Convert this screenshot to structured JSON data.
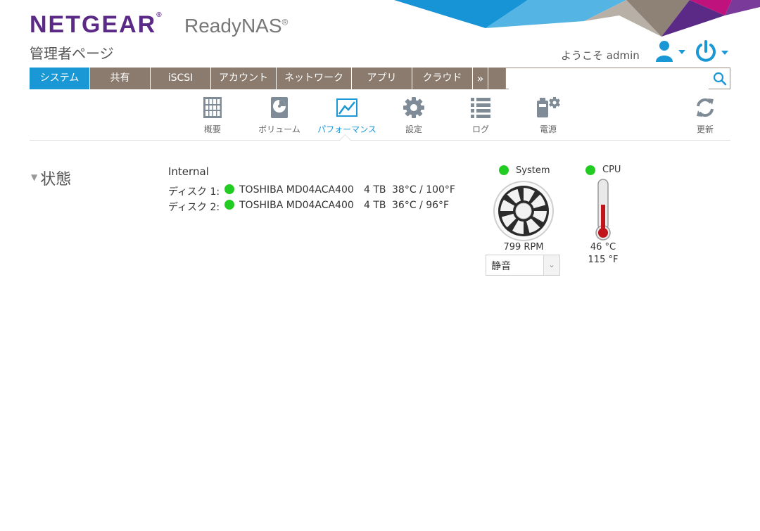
{
  "brand": {
    "name": "NETGEAR",
    "product": "ReadyNAS"
  },
  "header": {
    "title": "管理者ページ",
    "welcome": "ようこそ admin",
    "icons": {
      "user": "user-icon",
      "power": "power-icon",
      "search": "search-icon"
    }
  },
  "nav": {
    "tabs": [
      {
        "label": "システム",
        "active": true
      },
      {
        "label": "共有"
      },
      {
        "label": "iSCSI"
      },
      {
        "label": "アカウント"
      },
      {
        "label": "ネットワーク"
      },
      {
        "label": "アプリ"
      },
      {
        "label": "クラウド"
      }
    ],
    "more": "»",
    "search": {
      "value": "",
      "placeholder": ""
    }
  },
  "subnav": {
    "items": [
      {
        "label": "概要",
        "icon": "overview-icon"
      },
      {
        "label": "ボリューム",
        "icon": "volume-icon"
      },
      {
        "label": "パフォーマンス",
        "icon": "performance-icon",
        "active": true
      },
      {
        "label": "設定",
        "icon": "gear-icon"
      },
      {
        "label": "ログ",
        "icon": "log-icon"
      },
      {
        "label": "電源",
        "icon": "power-settings-icon"
      }
    ],
    "refresh": {
      "label": "更新",
      "icon": "refresh-icon"
    }
  },
  "status": {
    "section_title": "状態",
    "enclosure": "Internal",
    "disks": [
      {
        "label": "ディスク 1:",
        "model": "TOSHIBA MD04ACA400",
        "size": "4 TB",
        "temp": "38°C / 100°F",
        "status_color": "#22cc22"
      },
      {
        "label": "ディスク 2:",
        "model": "TOSHIBA MD04ACA400",
        "size": "4 TB",
        "temp": "36°C / 96°F",
        "status_color": "#22cc22"
      }
    ],
    "system_fan": {
      "title": "System",
      "rpm": "799 RPM",
      "mode": "静音",
      "status_color": "#22cc22"
    },
    "cpu": {
      "title": "CPU",
      "temp_c": "46 °C",
      "temp_f": "115 °F",
      "status_color": "#22cc22"
    }
  },
  "colors": {
    "accent": "#1a97d5",
    "tab_bg": "#8a7b6e",
    "brand": "#5b2a86",
    "ok": "#22cc22"
  }
}
